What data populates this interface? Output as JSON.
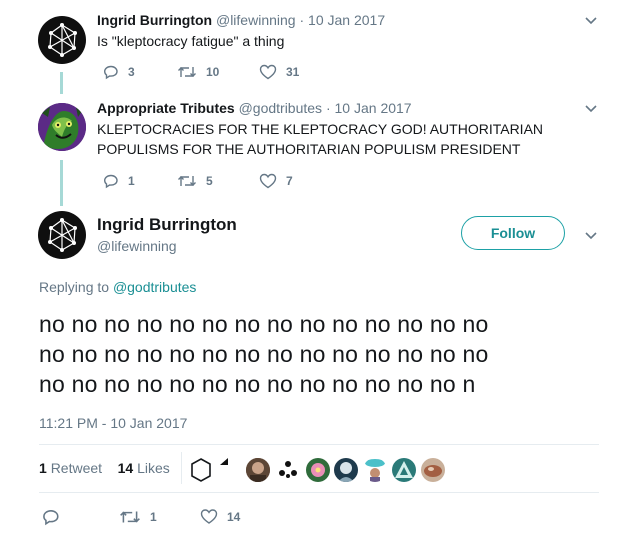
{
  "thread": [
    {
      "name": "Ingrid Burrington",
      "handle": "@lifewinning",
      "date": "10 Jan 2017",
      "text": "Is \"kleptocracy fatigue\" a thing",
      "replies": "3",
      "retweets": "10",
      "likes": "31"
    },
    {
      "name": "Appropriate Tributes",
      "handle": "@godtributes",
      "date": "10 Jan 2017",
      "text_line1": "KLEPTOCRACIES FOR THE KLEPTOCRACY GOD! AUTHORITARIAN",
      "text_line2": "POPULISMS FOR THE AUTHORITARIAN POPULISM PRESIDENT",
      "replies": "1",
      "retweets": "5",
      "likes": "7"
    }
  ],
  "main": {
    "name": "Ingrid Burrington",
    "handle": "@lifewinning",
    "follow_label": "Follow",
    "replying_prefix": "Replying to",
    "replying_handle": "@godtributes",
    "text_lines": [
      "no no no no no no no no no no no no no no",
      "no no no no no no no no no no no no no no",
      "no no no no no no no no no no no no no n"
    ],
    "timestamp": "11:21 PM - 10 Jan 2017",
    "retweet_count": "1",
    "retweet_label": "Retweet",
    "like_count": "14",
    "like_label": "Likes",
    "action_retweets": "1",
    "action_likes": "14"
  },
  "colors": {
    "accent": "#1a8f94",
    "thread_line": "#a6d9d6",
    "muted": "#657786",
    "text": "#14171a"
  }
}
